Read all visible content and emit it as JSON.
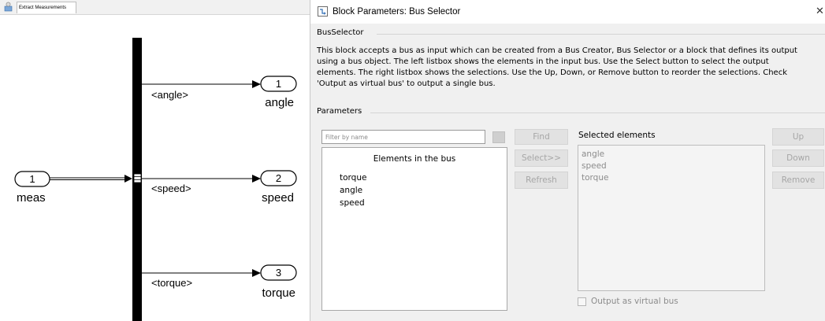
{
  "model": {
    "tab_label": "Extract Measurements",
    "input_port": {
      "number": "1",
      "name": "meas"
    },
    "signals": [
      {
        "label": "<angle>",
        "port_number": "1",
        "port_name": "angle"
      },
      {
        "label": "<speed>",
        "port_number": "2",
        "port_name": "speed"
      },
      {
        "label": "<torque>",
        "port_number": "3",
        "port_name": "torque"
      }
    ]
  },
  "dialog": {
    "title": "Block Parameters: Bus Selector",
    "close_glyph": "✕",
    "block_section": "BusSelector",
    "description_lines": [
      "This block accepts a bus as input which can be created from a Bus Creator, Bus Selector or a block that defines its output",
      "using a bus object. The left listbox shows the elements in the input bus. Use the Select button to select the output",
      "elements. The right listbox shows the selections. Use the Up, Down, or Remove button to reorder the selections. Check",
      "'Output as virtual bus' to output a single bus."
    ],
    "parameters_section": "Parameters",
    "filter_placeholder": "Filter by name",
    "bus_elements_header": "Elements in the bus",
    "bus_elements": [
      "torque",
      "angle",
      "speed"
    ],
    "buttons": {
      "find": "Find",
      "select": "Select>>",
      "refresh": "Refresh",
      "up": "Up",
      "down": "Down",
      "remove": "Remove"
    },
    "selected_label": "Selected elements",
    "selected_elements": [
      "angle",
      "speed",
      "torque"
    ],
    "virtual_bus_label": "Output as virtual bus",
    "virtual_bus_checked": false
  },
  "colors": {
    "bus_bar": "#000000",
    "disabled_text": "#a6a6a6",
    "dialog_bg": "#f0f0f0"
  }
}
